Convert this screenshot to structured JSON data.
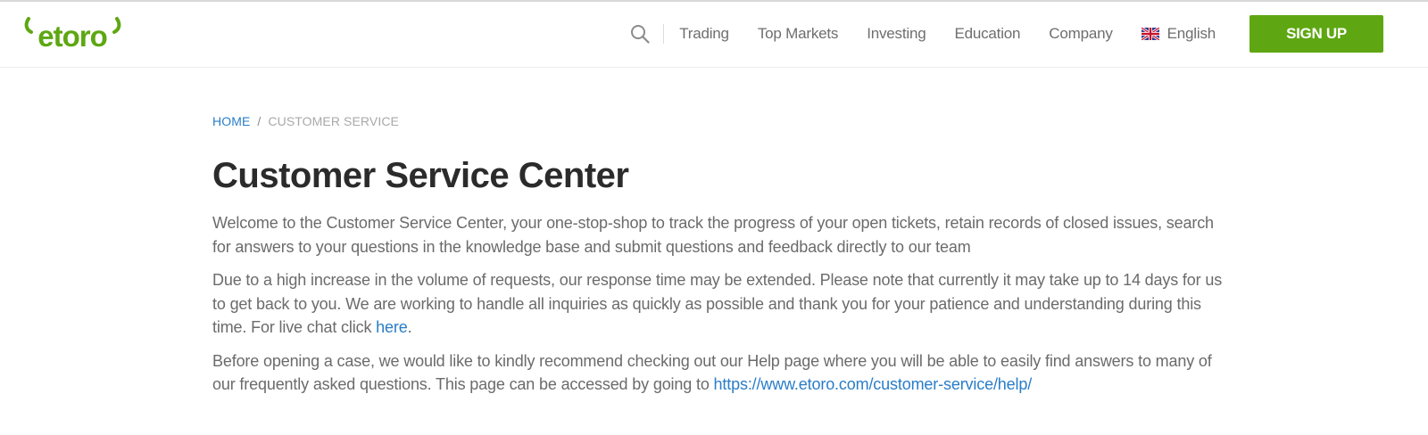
{
  "header": {
    "logo_text": "etoro",
    "nav": {
      "trading": "Trading",
      "top_markets": "Top Markets",
      "investing": "Investing",
      "education": "Education",
      "company": "Company"
    },
    "language": "English",
    "signup_label": "SIGN UP"
  },
  "breadcrumb": {
    "home": "HOME",
    "separator": "/",
    "current": "CUSTOMER SERVICE"
  },
  "main": {
    "title": "Customer Service Center",
    "intro": "Welcome to the Customer Service Center, your one-stop-shop to track the progress of your open tickets, retain records of closed issues, search for answers to your questions in the knowledge base and submit questions and feedback directly to our team",
    "notice_text": "Due to a high increase in the volume of requests, our response time may be extended. Please note that currently it may take up to 14 days for us to get back to you. We are working to handle all inquiries as quickly as possible and thank you for your patience and understanding during this time. For live chat click ",
    "notice_link": "here",
    "notice_end": ".",
    "help_text": "Before opening a case, we would like to kindly recommend checking out our Help page where you will be able to easily find answers to many of our frequently asked questions. This page can be accessed by going to ",
    "help_link": "https://www.etoro.com/customer-service/help/"
  },
  "colors": {
    "brand_green": "#5ea712",
    "link_blue": "#2a7dc9",
    "title_text": "#2b2b2b",
    "body_text": "#6b6b6b"
  },
  "icons": {
    "search": "search-icon",
    "flag": "uk-flag-icon",
    "logo": "etoro-logo"
  }
}
